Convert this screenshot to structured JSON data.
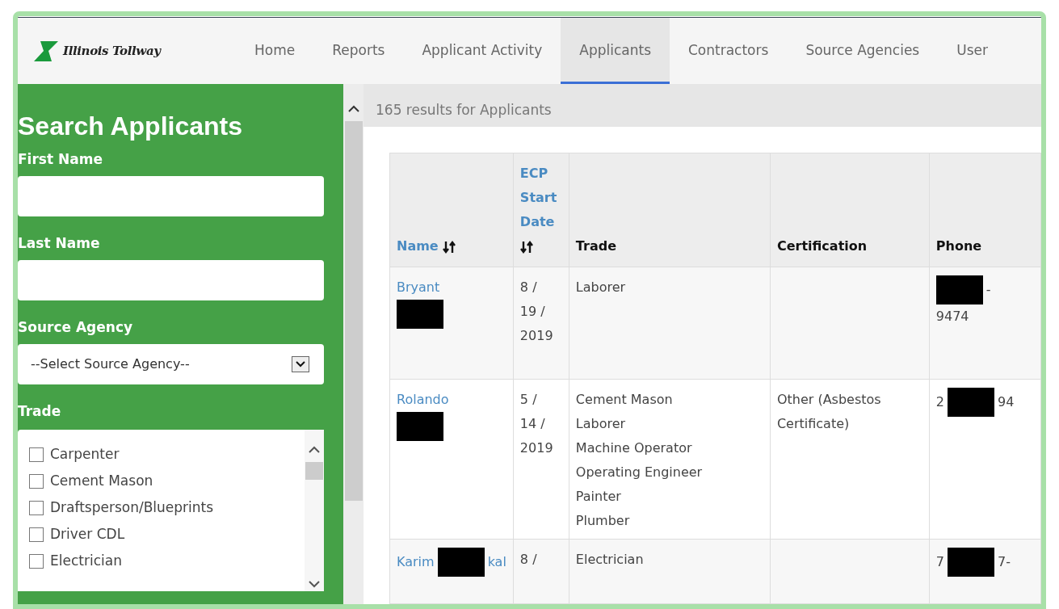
{
  "logo": {
    "text": "Illinois Tollway"
  },
  "nav": [
    {
      "label": "Home",
      "selected": false
    },
    {
      "label": "Reports",
      "selected": false
    },
    {
      "label": "Applicant Activity",
      "selected": false
    },
    {
      "label": "Applicants",
      "selected": true
    },
    {
      "label": "Contractors",
      "selected": false
    },
    {
      "label": "Source Agencies",
      "selected": false
    },
    {
      "label": "User",
      "selected": false
    }
  ],
  "sidebar": {
    "title": "Search Applicants",
    "fields": [
      {
        "kind": "text",
        "label": "First Name"
      },
      {
        "kind": "text",
        "label": "Last Name"
      },
      {
        "kind": "select",
        "label": "Source Agency",
        "value": "--Select Source Agency--"
      },
      {
        "kind": "checklist",
        "label": "Trade",
        "options": [
          {
            "label": "Carpenter",
            "checked": false
          },
          {
            "label": "Cement Mason",
            "checked": false
          },
          {
            "label": "Draftsperson/Blueprints",
            "checked": false
          },
          {
            "label": "Driver CDL",
            "checked": false
          },
          {
            "label": "Electrician",
            "checked": false
          }
        ]
      }
    ]
  },
  "results": {
    "summary": "165 results for Applicants"
  },
  "table": {
    "columns": [
      {
        "label": "Name",
        "sortable": true
      },
      {
        "label": "ECP Start Date",
        "sortable": true
      },
      {
        "label": "Trade",
        "sortable": false
      },
      {
        "label": "Certification",
        "sortable": false
      },
      {
        "label": "Phone",
        "sortable": false
      }
    ],
    "rows": [
      {
        "name": [
          [
            {
              "text": "Bryant"
            }
          ],
          [
            {
              "kind": "redacted"
            }
          ]
        ],
        "date": "8 / 19 / 2019",
        "trade": [
          "Laborer"
        ],
        "certification": "",
        "phone": [
          [
            {
              "kind": "redacted"
            },
            {
              "text": "-"
            }
          ],
          [
            {
              "text": "9474"
            }
          ]
        ]
      },
      {
        "name": [
          [
            {
              "text": "Rolando"
            }
          ],
          [
            {
              "kind": "redacted"
            }
          ]
        ],
        "date": "5 / 14 / 2019",
        "trade": [
          "Cement Mason",
          "Laborer",
          "Machine Operator",
          "Operating Engineer",
          "Painter",
          "Plumber"
        ],
        "certification": "Other (Asbestos Certificate)",
        "phone": [
          [
            {
              "text": "2"
            },
            {
              "kind": "redacted"
            },
            {
              "text": "94"
            }
          ]
        ]
      },
      {
        "name": [
          [
            {
              "text": "Karim"
            },
            {
              "kind": "redacted"
            },
            {
              "text": "kal"
            }
          ]
        ],
        "date": "8 /",
        "trade": [
          "Electrician"
        ],
        "certification": "",
        "phone": [
          [
            {
              "text": "7"
            },
            {
              "kind": "redacted"
            },
            {
              "text": "7-"
            }
          ]
        ]
      }
    ]
  }
}
